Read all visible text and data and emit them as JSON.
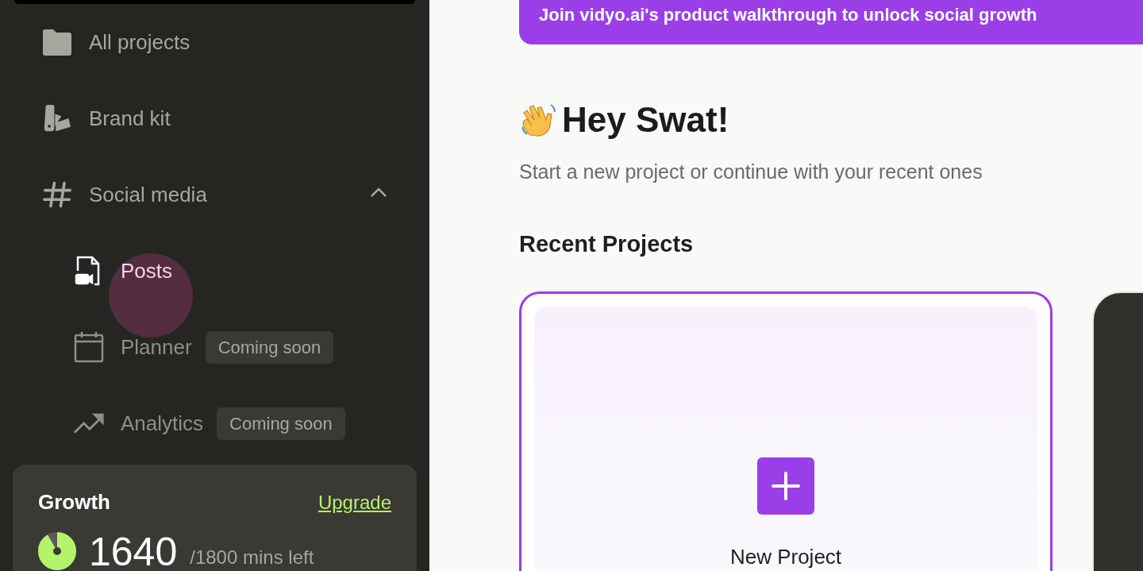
{
  "banner": {
    "text": "Join vidyo.ai's product walkthrough to unlock social growth"
  },
  "sidebar": {
    "items": [
      {
        "kind": "folder",
        "label": "All projects",
        "selected": false
      },
      {
        "kind": "swatch",
        "label": "Brand kit",
        "selected": false
      },
      {
        "kind": "hash",
        "label": "Social media",
        "selected": false,
        "expanded": true,
        "children": [
          {
            "kind": "post",
            "label": "Posts",
            "selected": true
          },
          {
            "kind": "calendar",
            "label": "Planner",
            "selected": false,
            "badge": "Coming soon"
          },
          {
            "kind": "trend",
            "label": "Analytics",
            "selected": false,
            "badge": "Coming soon"
          }
        ]
      }
    ]
  },
  "plan": {
    "name": "Growth",
    "upgrade": "Upgrade",
    "remaining": "1640",
    "total": "/1800 mins left",
    "level": 0.91
  },
  "greeting": {
    "title": "Hey Swat!",
    "subtitle": "Start a new project or continue with your recent ones"
  },
  "recent": {
    "title": "Recent Projects",
    "new_project": "New Project"
  }
}
